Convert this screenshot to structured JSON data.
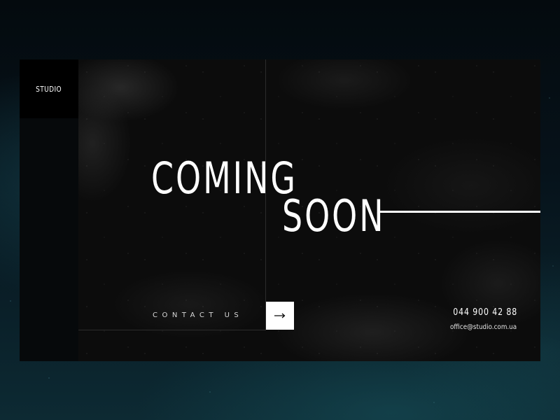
{
  "brand": {
    "logo_text": "STUDIO"
  },
  "hero": {
    "headline_line1": "COMING",
    "headline_line2": "SOON"
  },
  "contact": {
    "label": "CONTACT US",
    "arrow_icon": "arrow-right-icon",
    "phone": "044 900 42 88",
    "email": "office@studio.com.ua"
  },
  "colors": {
    "accent": "#ffffff",
    "panel": "#0c0c0c",
    "sidebar": "#06090b",
    "background": "#06121a"
  }
}
